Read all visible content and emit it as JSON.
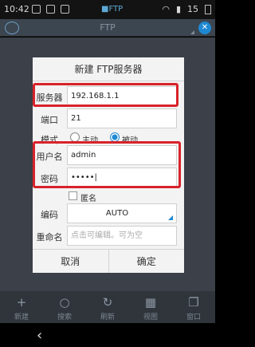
{
  "statusbar": {
    "time": "10:42",
    "chip": "■FTP",
    "battery": "15"
  },
  "app": {
    "title": "FTP"
  },
  "dialog": {
    "title": "新建 FTP服务器",
    "server": {
      "label": "服务器",
      "value": "192.168.1.1"
    },
    "port": {
      "label": "端口",
      "value": "21"
    },
    "mode": {
      "label": "模式",
      "option_active": "主动",
      "option_passive": "被动",
      "selected": "被动"
    },
    "username": {
      "label": "用户名",
      "value": "admin"
    },
    "password": {
      "label": "密码",
      "value": "•••••|"
    },
    "anonymous": {
      "label": "匿名",
      "checked": false
    },
    "encoding": {
      "label": "编码",
      "value": "AUTO"
    },
    "rename": {
      "label": "重命名",
      "placeholder": "点击可编辑。可为空"
    },
    "cancel_label": "取消",
    "confirm_label": "确定"
  },
  "toolbar": {
    "items": [
      "新建",
      "搜索",
      "刷新",
      "视图",
      "窗口"
    ]
  },
  "nav": {
    "back": "‹"
  }
}
